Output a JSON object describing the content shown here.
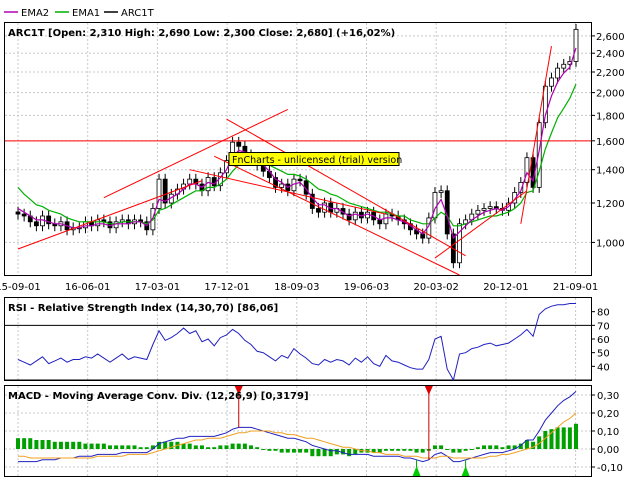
{
  "legend": [
    {
      "name": "EMA2",
      "color": "#b000b0"
    },
    {
      "name": "EMA1",
      "color": "#00b000"
    },
    {
      "name": "ARC1T",
      "color": "#000000"
    }
  ],
  "price_panel": {
    "title": "ARC1T [Open: 2,310  High: 2,690  Low: 2,300  Close: 2,680] (+16,02%)",
    "watermark": "FnCharts - unlicensed (trial) version",
    "y_ticks": [
      "2,600",
      "2,400",
      "2,200",
      "2,000",
      "1,800",
      "1,600",
      "1,400",
      "1,200",
      "1,000"
    ],
    "x_ticks": [
      "15-09-01",
      "16-06-01",
      "17-03-01",
      "17-12-01",
      "18-09-03",
      "19-06-03",
      "20-03-02",
      "20-12-01",
      "21-09-01"
    ]
  },
  "rsi_panel": {
    "title": "RSI - Relative Strength Index (14,30,70) [86,06]",
    "y_ticks": [
      "80",
      "70",
      "60",
      "50",
      "40"
    ]
  },
  "macd_panel": {
    "title": "MACD - Moving Average Conv. Div. (12,26,9) [0,3179]",
    "y_ticks": [
      "0,30",
      "0,20",
      "0,10",
      "0,00",
      "-0,10"
    ]
  },
  "colors": {
    "bull_fill": "#ffffff",
    "bear_fill": "#000000",
    "ema1": "#00b000",
    "ema2": "#b000b0",
    "trend": "#ff0000",
    "rsi": "#2020c0",
    "macd": "#2020c0",
    "signal": "#f0a020",
    "hist": "#00a000",
    "grid": "#c8c8c8",
    "watermark_bg": "#ffff00"
  },
  "chart_data": [
    {
      "type": "candlestick",
      "title": "ARC1T [Open: 2,310  High: 2,690  Low: 2,300  Close: 2,680] (+16,02%)",
      "x": [
        "15-09-01",
        "16-06-01",
        "17-03-01",
        "17-12-01",
        "18-09-03",
        "19-06-03",
        "20-03-02",
        "20-12-01",
        "21-09-01"
      ],
      "ylim": [
        0.86,
        2.76
      ],
      "y_scale": "log",
      "last_bar": {
        "open": 2.31,
        "high": 2.69,
        "low": 2.3,
        "close": 2.68,
        "change_pct": 16.02
      },
      "close": [
        1.14,
        1.13,
        1.1,
        1.08,
        1.13,
        1.09,
        1.08,
        1.1,
        1.06,
        1.07,
        1.07,
        1.1,
        1.08,
        1.11,
        1.1,
        1.07,
        1.1,
        1.11,
        1.09,
        1.11,
        1.1,
        1.06,
        1.17,
        1.34,
        1.2,
        1.25,
        1.28,
        1.31,
        1.34,
        1.31,
        1.27,
        1.35,
        1.3,
        1.38,
        1.46,
        1.59,
        1.56,
        1.5,
        1.48,
        1.43,
        1.39,
        1.35,
        1.29,
        1.31,
        1.27,
        1.34,
        1.33,
        1.25,
        1.17,
        1.15,
        1.2,
        1.15,
        1.17,
        1.14,
        1.11,
        1.15,
        1.12,
        1.15,
        1.11,
        1.09,
        1.14,
        1.13,
        1.11,
        1.09,
        1.06,
        1.04,
        1.02,
        1.12,
        1.26,
        1.27,
        1.04,
        0.91,
        1.09,
        1.11,
        1.14,
        1.16,
        1.17,
        1.18,
        1.17,
        1.16,
        1.2,
        1.26,
        1.32,
        1.48,
        1.29,
        1.74,
        2.06,
        2.14,
        2.24,
        2.28,
        2.31,
        2.68
      ],
      "series": [
        {
          "name": "EMA1",
          "values": [
            1.29,
            1.25,
            1.22,
            1.19,
            1.18,
            1.16,
            1.15,
            1.14,
            1.12,
            1.11,
            1.1,
            1.1,
            1.1,
            1.1,
            1.1,
            1.09,
            1.09,
            1.1,
            1.1,
            1.1,
            1.1,
            1.09,
            1.11,
            1.16,
            1.17,
            1.19,
            1.21,
            1.23,
            1.25,
            1.27,
            1.27,
            1.29,
            1.29,
            1.31,
            1.34,
            1.39,
            1.43,
            1.45,
            1.46,
            1.46,
            1.45,
            1.43,
            1.41,
            1.39,
            1.37,
            1.37,
            1.36,
            1.34,
            1.31,
            1.28,
            1.27,
            1.25,
            1.24,
            1.22,
            1.2,
            1.19,
            1.18,
            1.17,
            1.16,
            1.15,
            1.15,
            1.14,
            1.13,
            1.13,
            1.11,
            1.1,
            1.09,
            1.09,
            1.12,
            1.15,
            1.13,
            1.08,
            1.08,
            1.09,
            1.1,
            1.11,
            1.12,
            1.13,
            1.13,
            1.14,
            1.15,
            1.17,
            1.2,
            1.26,
            1.27,
            1.39,
            1.54,
            1.66,
            1.78,
            1.86,
            1.95,
            2.08
          ]
        },
        {
          "name": "EMA2",
          "values": [
            1.17,
            1.15,
            1.13,
            1.11,
            1.11,
            1.1,
            1.09,
            1.09,
            1.08,
            1.07,
            1.07,
            1.08,
            1.08,
            1.09,
            1.09,
            1.08,
            1.09,
            1.09,
            1.09,
            1.1,
            1.1,
            1.08,
            1.12,
            1.22,
            1.21,
            1.23,
            1.25,
            1.28,
            1.31,
            1.31,
            1.29,
            1.32,
            1.31,
            1.35,
            1.4,
            1.49,
            1.53,
            1.52,
            1.5,
            1.46,
            1.43,
            1.39,
            1.34,
            1.32,
            1.29,
            1.31,
            1.32,
            1.28,
            1.23,
            1.19,
            1.19,
            1.17,
            1.17,
            1.15,
            1.13,
            1.14,
            1.13,
            1.14,
            1.13,
            1.11,
            1.12,
            1.12,
            1.11,
            1.1,
            1.08,
            1.06,
            1.04,
            1.08,
            1.17,
            1.22,
            1.13,
            1.02,
            1.05,
            1.08,
            1.11,
            1.13,
            1.15,
            1.16,
            1.17,
            1.16,
            1.18,
            1.22,
            1.27,
            1.38,
            1.33,
            1.53,
            1.8,
            1.97,
            2.1,
            2.19,
            2.25,
            2.46
          ]
        }
      ],
      "annotations": [
        {
          "label": "resistance",
          "y": 1.6
        }
      ]
    },
    {
      "type": "line",
      "title": "RSI - Relative Strength Index (14,30,70) [86,06]",
      "ylim": [
        30,
        90
      ],
      "levels": [
        30,
        70
      ],
      "series": [
        {
          "name": "RSI",
          "values": [
            45,
            43,
            41,
            44,
            47,
            42,
            44,
            46,
            43,
            45,
            45,
            47,
            46,
            49,
            46,
            43,
            46,
            49,
            45,
            47,
            46,
            45,
            56,
            66,
            59,
            61,
            64,
            68,
            64,
            66,
            58,
            60,
            55,
            61,
            63,
            67,
            64,
            59,
            56,
            51,
            50,
            47,
            44,
            48,
            46,
            53,
            49,
            46,
            42,
            41,
            45,
            43,
            45,
            44,
            41,
            46,
            43,
            47,
            42,
            40,
            48,
            44,
            43,
            41,
            39,
            38,
            38,
            45,
            60,
            62,
            38,
            30,
            49,
            50,
            53,
            54,
            56,
            57,
            55,
            56,
            57,
            60,
            63,
            67,
            62,
            78,
            82,
            84,
            85,
            85,
            86,
            86
          ]
        }
      ]
    },
    {
      "type": "bar",
      "title": "MACD - Moving Average Conv. Div. (12,26,9) [0,3179]",
      "ylim": [
        -0.15,
        0.35
      ],
      "series": [
        {
          "name": "MACD",
          "values": [
            -0.07,
            -0.07,
            -0.07,
            -0.07,
            -0.06,
            -0.06,
            -0.06,
            -0.05,
            -0.05,
            -0.05,
            -0.04,
            -0.04,
            -0.04,
            -0.03,
            -0.03,
            -0.03,
            -0.03,
            -0.02,
            -0.02,
            -0.02,
            -0.02,
            -0.02,
            0.0,
            0.03,
            0.04,
            0.05,
            0.06,
            0.06,
            0.07,
            0.07,
            0.07,
            0.07,
            0.07,
            0.08,
            0.09,
            0.11,
            0.12,
            0.12,
            0.12,
            0.11,
            0.1,
            0.09,
            0.08,
            0.07,
            0.06,
            0.06,
            0.05,
            0.04,
            0.02,
            0.01,
            0.0,
            -0.01,
            -0.01,
            -0.02,
            -0.03,
            -0.03,
            -0.03,
            -0.03,
            -0.04,
            -0.04,
            -0.04,
            -0.04,
            -0.04,
            -0.05,
            -0.05,
            -0.06,
            -0.07,
            -0.06,
            -0.03,
            -0.02,
            -0.04,
            -0.07,
            -0.07,
            -0.06,
            -0.05,
            -0.04,
            -0.03,
            -0.02,
            -0.02,
            -0.02,
            -0.01,
            0.0,
            0.02,
            0.05,
            0.05,
            0.1,
            0.16,
            0.2,
            0.24,
            0.27,
            0.29,
            0.32
          ]
        },
        {
          "name": "Signal",
          "values": [
            -0.04,
            -0.04,
            -0.05,
            -0.05,
            -0.05,
            -0.05,
            -0.05,
            -0.05,
            -0.05,
            -0.05,
            -0.05,
            -0.05,
            -0.05,
            -0.04,
            -0.04,
            -0.04,
            -0.04,
            -0.04,
            -0.03,
            -0.03,
            -0.03,
            -0.03,
            -0.02,
            -0.01,
            0.0,
            0.01,
            0.02,
            0.03,
            0.04,
            0.05,
            0.05,
            0.06,
            0.06,
            0.06,
            0.07,
            0.08,
            0.09,
            0.09,
            0.1,
            0.1,
            0.1,
            0.1,
            0.09,
            0.09,
            0.08,
            0.08,
            0.07,
            0.06,
            0.06,
            0.05,
            0.04,
            0.03,
            0.02,
            0.01,
            0.01,
            0.0,
            -0.01,
            -0.01,
            -0.02,
            -0.02,
            -0.03,
            -0.03,
            -0.03,
            -0.04,
            -0.04,
            -0.04,
            -0.05,
            -0.05,
            -0.05,
            -0.04,
            -0.04,
            -0.05,
            -0.05,
            -0.05,
            -0.05,
            -0.05,
            -0.05,
            -0.04,
            -0.04,
            -0.03,
            -0.03,
            -0.02,
            -0.01,
            0.0,
            0.01,
            0.03,
            0.06,
            0.09,
            0.12,
            0.15,
            0.17,
            0.2
          ]
        },
        {
          "name": "Histogram",
          "values": [
            0.06,
            0.06,
            0.06,
            0.05,
            0.05,
            0.05,
            0.04,
            0.04,
            0.04,
            0.04,
            0.04,
            0.03,
            0.03,
            0.03,
            0.03,
            0.02,
            0.02,
            0.02,
            0.02,
            0.02,
            0.01,
            0.01,
            0.02,
            0.04,
            0.04,
            0.04,
            0.04,
            0.03,
            0.03,
            0.02,
            0.02,
            0.01,
            0.01,
            0.02,
            0.02,
            0.03,
            0.03,
            0.03,
            0.02,
            0.01,
            0.0,
            -0.01,
            -0.01,
            -0.02,
            -0.02,
            -0.02,
            -0.02,
            -0.02,
            -0.04,
            -0.04,
            -0.04,
            -0.04,
            -0.03,
            -0.03,
            -0.04,
            -0.03,
            -0.02,
            -0.02,
            -0.02,
            -0.02,
            -0.01,
            -0.01,
            -0.01,
            -0.01,
            -0.01,
            -0.02,
            -0.02,
            -0.01,
            0.02,
            0.02,
            0.0,
            -0.02,
            -0.02,
            -0.01,
            0.0,
            0.01,
            0.02,
            0.02,
            0.02,
            0.01,
            0.02,
            0.02,
            0.03,
            0.05,
            0.04,
            0.07,
            0.1,
            0.11,
            0.12,
            0.12,
            0.12,
            0.14
          ]
        }
      ],
      "annotations": [
        {
          "label": "sell",
          "index": 36
        },
        {
          "label": "sell",
          "index": 67
        },
        {
          "label": "buy",
          "index": 65
        },
        {
          "label": "buy",
          "index": 73
        }
      ]
    }
  ]
}
